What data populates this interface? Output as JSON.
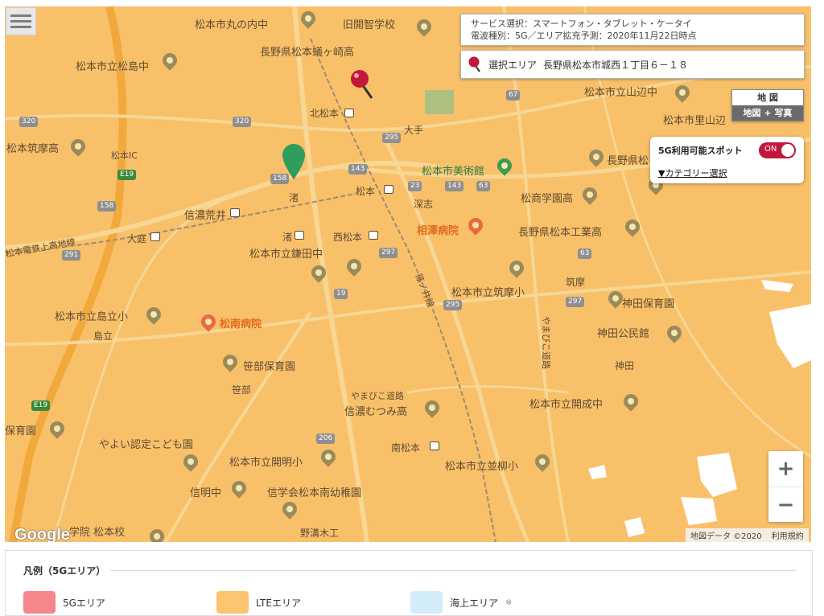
{
  "service": {
    "line1": "サービス選択：スマートフォン・タブレット・ケータイ",
    "line2": "電波種別：5G／エリア拡充予測：2020年11月22日時点"
  },
  "area": {
    "label": "選択エリア",
    "address": "長野県松本市城西１丁目６－１８"
  },
  "maptype": {
    "map": "地 図",
    "hybrid": "地図 + 写真"
  },
  "spot": {
    "title": "5G利用可能スポット",
    "toggle": "ON",
    "category": "▼カテゴリー選択"
  },
  "zoom": {
    "in": "+",
    "out": "−"
  },
  "google": "Google",
  "attribution": {
    "data": "地図データ ©2020",
    "terms": "利用規約"
  },
  "legend": {
    "title": "凡例（5Gエリア）",
    "items": [
      {
        "label": "5Gエリア",
        "color": "#f5868a"
      },
      {
        "label": "LTEエリア",
        "color": "#fbc46e"
      },
      {
        "label": "海上エリア",
        "color": "#d3ecfa",
        "note": "※"
      }
    ]
  },
  "colors": {
    "lte": "#f9c06a",
    "road": "#f7d794",
    "highway": "#f2a93b",
    "rail": "#9c8c76",
    "accent": "#c4153a",
    "marker_green": "#2f9d5b",
    "marker_red": "#c4153a"
  },
  "map_labels": {
    "maru": "松本市丸の内中",
    "kaichi": "旧開智学校",
    "agatagaoka": "長野県松本蟻ヶ崎高",
    "shimajinaka": "松本市立松島中",
    "kitamatsumoto": "北松本",
    "otemae": "大手",
    "yamabechu": "松本市立山辺中",
    "satoyama": "松本市里山辺",
    "chikuma": "松本筑摩高",
    "ic": "松本IC",
    "museum": "松本市美術館",
    "nagano_kogei": "長野県松",
    "fukashi": "深志",
    "matsumoto_st": "松本",
    "nagisa": "渚",
    "shinanoarai": "信濃荒井",
    "kowa": "松商学園高",
    "aizawa": "相澤病院",
    "kogyo": "長野県松本工業高",
    "oniwa": "大庭",
    "nagisa2": "渚",
    "nishimatsumoto": "西松本",
    "kamanuta": "松本市立鎌田中",
    "kamikochi_line": "松本電鉄上高地線",
    "shinonoi": "篠ノ井線",
    "chikuma_sho": "松本市立筑摩小",
    "chikuma2": "筑摩",
    "kanda_hoiku": "神田保育園",
    "shimadachi_sho": "松本市立島立小",
    "matsunan": "松南病院",
    "shimadachi": "島立",
    "yamabiko": "やまびこ道路",
    "kanda_kominkan": "神田公民館",
    "sasabe_hoiku": "笹部保育園",
    "kanda": "神田",
    "sasabe": "笹部",
    "yamabiko2": "やまびこ道路",
    "mutsumi": "信濃むつみ高",
    "kaimei": "松本市立開成中",
    "hoikuen": "保育園",
    "yayoi": "やよい認定こども園",
    "minamimatsumoto": "南松本",
    "kaimei_sho": "松本市立開明小",
    "namiyanagi": "松本市立並柳小",
    "shinmei": "信明中",
    "shingakukai": "信学会松本南幼稚園",
    "gakuin": "学院 松本校",
    "nomizo": "野溝木工"
  },
  "road_numbers": {
    "r320a": "320",
    "r320b": "320",
    "r295a": "295",
    "r158a": "158",
    "r158b": "158",
    "r143a": "143",
    "r143b": "143",
    "r23": "23",
    "r63a": "63",
    "r67": "67",
    "r291": "291",
    "r297a": "297",
    "r19": "19",
    "r295b": "295",
    "r63b": "63",
    "r297b": "297",
    "r206": "206",
    "e19a": "E19",
    "e19b": "E19"
  }
}
